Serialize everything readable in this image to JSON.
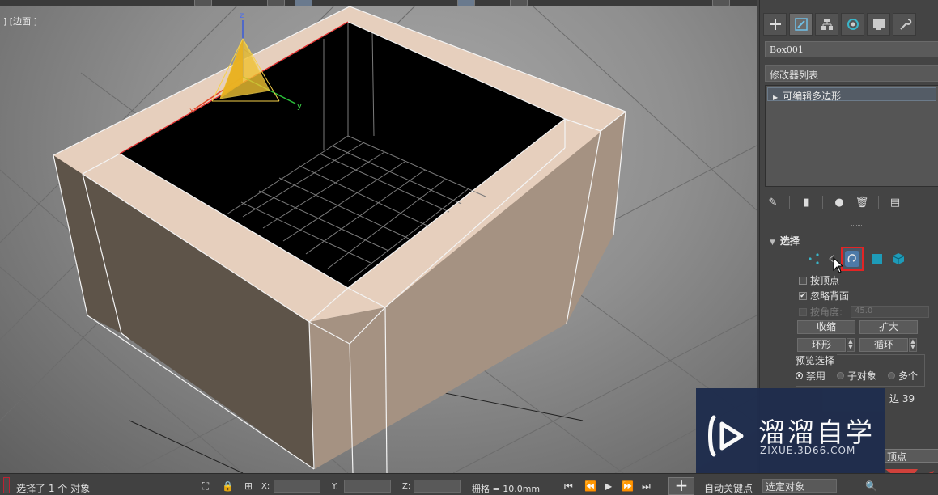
{
  "viewport": {
    "label": "] [边面 ]",
    "gizmo": {
      "z": "z",
      "y": "y",
      "x": "x"
    }
  },
  "command_panel": {
    "tabs": [
      {
        "icon": "plus-icon"
      },
      {
        "icon": "modify-icon"
      },
      {
        "icon": "hierarchy-icon"
      },
      {
        "icon": "motion-icon"
      },
      {
        "icon": "display-icon"
      },
      {
        "icon": "utilities-icon"
      }
    ],
    "object_name": "Box001",
    "modifier_list": "修改器列表",
    "stack_item": "可编辑多边形",
    "selection": {
      "title": "选择",
      "by_vertex": "按顶点",
      "ignore_backfacing": "忽略背面",
      "by_angle": "按角度:",
      "angle_value": "45.0",
      "shrink": "收缩",
      "grow": "扩大",
      "ring": "环形",
      "loop": "循环",
      "preview_title": "预览选择",
      "preview_options": [
        "禁用",
        "子对象",
        "多个"
      ],
      "edge_count_label": "边 39",
      "vertex_button": "顶点"
    }
  },
  "status_bar": {
    "selection_text": "选择了 1 个 对象",
    "x_label": "X:",
    "y_label": "Y:",
    "z_label": "Z:",
    "grid": "栅格 = 10.0mm",
    "auto_key": "自动关键点",
    "selected_object": "选定对象"
  },
  "watermark": {
    "cn": "溜溜自学",
    "url": "ZIXUE.3D66.COM"
  },
  "colors": {
    "box_top": "#e6cfbd",
    "box_side_left": "#5e5449",
    "box_side_right": "#a59282",
    "interior": "#000000",
    "highlight": "#e32424",
    "watermark_bg": "#1f2d4d"
  }
}
